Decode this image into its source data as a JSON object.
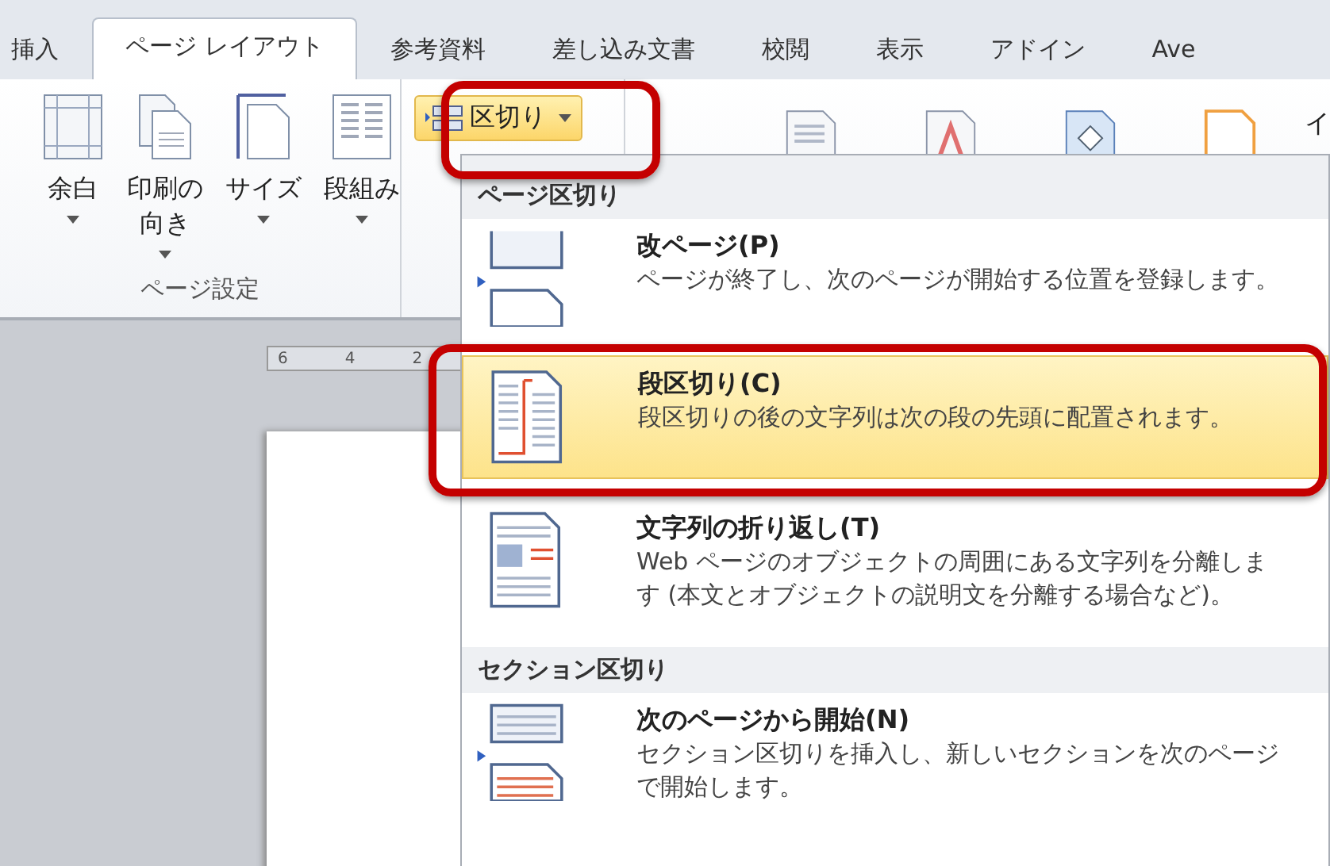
{
  "tabs": [
    {
      "label": "挿入",
      "selected": false
    },
    {
      "label": "ページ レイアウト",
      "selected": true
    },
    {
      "label": "参考資料",
      "selected": false
    },
    {
      "label": "差し込み文書",
      "selected": false
    },
    {
      "label": "校閲",
      "selected": false
    },
    {
      "label": "表示",
      "selected": false
    },
    {
      "label": "アドイン",
      "selected": false
    },
    {
      "label": "Ave",
      "selected": false
    }
  ],
  "ribbon": {
    "page_setup": {
      "label": "ページ設定",
      "buttons": [
        {
          "kind": "margins",
          "lines": [
            "余白"
          ]
        },
        {
          "kind": "orientation",
          "lines": [
            "印刷の",
            "向き"
          ]
        },
        {
          "kind": "size",
          "lines": [
            "サイズ"
          ]
        },
        {
          "kind": "columns",
          "lines": [
            "段組み"
          ]
        }
      ]
    },
    "breaks_button": {
      "label": "区切り",
      "highlighted": true
    },
    "right_label": "イ"
  },
  "ruler": [
    "6",
    "4",
    "2"
  ],
  "breaks_menu": {
    "sections": [
      {
        "heading": "ページ区切り",
        "items": [
          {
            "kind": "page",
            "title": "改ページ(P)",
            "description": "ページが終了し、次のページが開始する位置を登録します。",
            "selected": false
          },
          {
            "kind": "column",
            "title": "段区切り(C)",
            "description": "段区切りの後の文字列は次の段の先頭に配置されます。",
            "selected": true
          },
          {
            "kind": "wrap",
            "title": "文字列の折り返し(T)",
            "description": "Web ページのオブジェクトの周囲にある文字列を分離します (本文とオブジェクトの説明文を分離する場合など)。",
            "selected": false
          }
        ]
      },
      {
        "heading": "セクション区切り",
        "items": [
          {
            "kind": "next-page",
            "title": "次のページから開始(N)",
            "description": "セクション区切りを挿入し、新しいセクションを次のページで開始します。",
            "selected": false
          }
        ]
      }
    ]
  }
}
